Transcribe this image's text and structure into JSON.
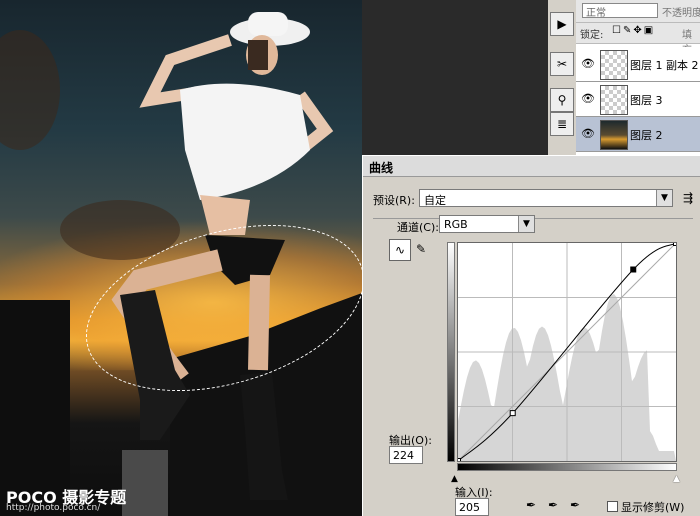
{
  "watermark": {
    "brand": "POCO 摄影专题",
    "url": "http://photo.poco.cn/"
  },
  "layers_panel": {
    "blend_mode": "正常",
    "opacity_label": "不透明度",
    "lock_label": "锁定:",
    "fill_label": "填充",
    "layers": [
      {
        "name": "图层 1 副本 2",
        "thumb": "figure",
        "active": false
      },
      {
        "name": "图层 3",
        "thumb": "transparent",
        "active": false
      },
      {
        "name": "图层 2",
        "thumb": "photo",
        "active": true
      }
    ]
  },
  "curves": {
    "title": "曲线",
    "preset_label": "预设(R):",
    "preset_value": "自定",
    "channel_label": "通道(C):",
    "channel_value": "RGB",
    "output_label": "输出(O):",
    "output_value": "224",
    "input_label": "输入(I):",
    "input_value": "205",
    "show_clipping_label": "显示修剪(W)",
    "show_clipping_checked": false,
    "curve_points": [
      [
        0,
        0
      ],
      [
        64,
        56
      ],
      [
        205,
        224
      ],
      [
        255,
        255
      ]
    ],
    "accent_color": "#000000"
  },
  "icons": [
    "eye-icon",
    "curve-tool-icon",
    "pencil-icon",
    "eyedropper-black-icon",
    "eyedropper-gray-icon",
    "eyedropper-white-icon",
    "dropdown-arrow-icon",
    "menu-icon"
  ]
}
